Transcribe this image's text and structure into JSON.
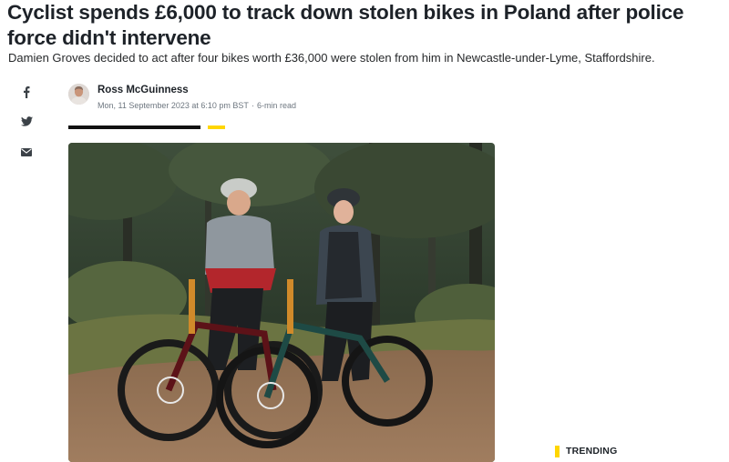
{
  "article": {
    "headline": "Cyclist spends £6,000 to track down stolen bikes in Poland after police force didn't intervene",
    "subheadline": "Damien Groves decided to act after four bikes worth £36,000 were stolen from him in Newcastle-under-Lyme, Staffordshire.",
    "author": "Ross McGuinness",
    "published": "Mon, 11 September 2023 at 6:10 pm BST",
    "separator": "·",
    "read_time": "6-min read"
  },
  "share": {
    "icons": [
      "facebook-icon",
      "twitter-icon",
      "email-icon"
    ]
  },
  "sidebar": {
    "trending_label": "TRENDING"
  },
  "colors": {
    "accent": "#ffd600",
    "headline": "#1d2228",
    "meta": "#6e7780"
  }
}
